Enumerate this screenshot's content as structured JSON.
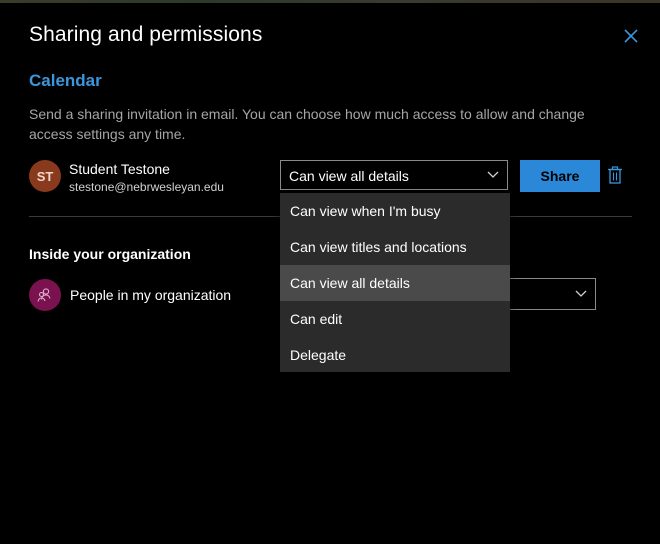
{
  "dialog": {
    "title": "Sharing and permissions",
    "section_title": "Calendar",
    "description": "Send a sharing invitation in email. You can choose how much access to allow and change access settings any time."
  },
  "recipient": {
    "initials": "ST",
    "name": "Student Testone",
    "email": "stestone@nebrwesleyan.edu",
    "permission": "Can view all details",
    "share_label": "Share"
  },
  "organization": {
    "title": "Inside your organization",
    "name": "People in my organization",
    "permission_visible": "s"
  },
  "dropdown": {
    "options": [
      "Can view when I'm busy",
      "Can view titles and locations",
      "Can view all details",
      "Can edit",
      "Delegate"
    ],
    "selected_index": 2
  },
  "colors": {
    "accent": "#3a96dd",
    "share_button": "#2b88d8",
    "avatar_st": "#8a3a1c",
    "avatar_org": "#7a1250",
    "dropdown_bg": "#2b2b2b",
    "dropdown_selected": "#4a4a4a"
  },
  "icons": {
    "close": "close-icon",
    "chevron": "chevron-down-icon",
    "delete": "trash-icon",
    "people": "people-icon"
  }
}
